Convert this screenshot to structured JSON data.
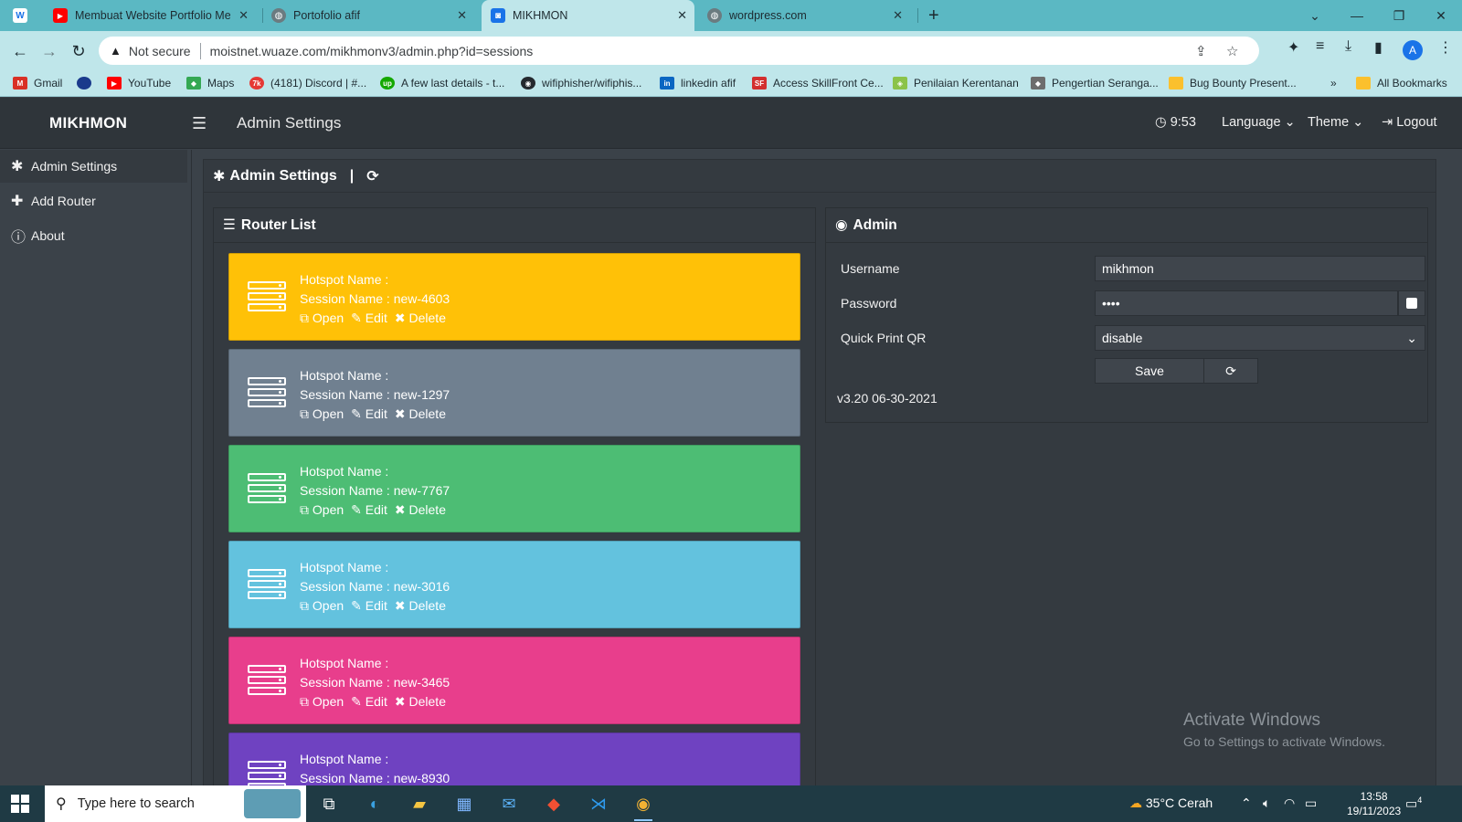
{
  "browser": {
    "tabs": [
      {
        "title": "Membuat Website Portfolio Men",
        "icon": "youtube-icon"
      },
      {
        "title": "Portofolio afif",
        "icon": "globe-icon"
      },
      {
        "title": "MIKHMON",
        "icon": "mikhmon-icon"
      },
      {
        "title": "wordpress.com",
        "icon": "globe-icon"
      }
    ],
    "not_secure": "Not secure",
    "url": "moistnet.wuaze.com/mikhmonv3/admin.php?id=sessions",
    "avatar": "A",
    "bookmarks": [
      {
        "label": "Gmail",
        "color": "#d93025"
      },
      {
        "label": "",
        "color": "#1a3a8c"
      },
      {
        "label": "YouTube",
        "color": "#ff0000"
      },
      {
        "label": "Maps",
        "color": "#34a853"
      },
      {
        "label": "(4181) Discord | #...",
        "color": "#e53935"
      },
      {
        "label": "A few last details - t...",
        "color": "#14a800"
      },
      {
        "label": "wifiphisher/wifiphis...",
        "color": "#24292e"
      },
      {
        "label": "linkedin afif",
        "color": "#0a66c2"
      },
      {
        "label": "Access SkillFront Ce...",
        "color": "#d32f2f"
      },
      {
        "label": "Penilaian Kerentanan",
        "color": "#8bc34a"
      },
      {
        "label": "Pengertian Seranga...",
        "color": "#6d6d6d"
      },
      {
        "label": "Bug Bounty Present...",
        "color": "#fbc02d"
      }
    ],
    "all_bookmarks": "All Bookmarks",
    "more_bookmarks": "»"
  },
  "app": {
    "brand": "MIKHMON",
    "page_title": "Admin Settings",
    "time": "9:53",
    "language": "Language",
    "theme": "Theme",
    "logout": "Logout"
  },
  "sidebar": {
    "items": [
      {
        "label": "Admin Settings",
        "icon": "gear-icon"
      },
      {
        "label": "Add Router",
        "icon": "plus-icon"
      },
      {
        "label": "About",
        "icon": "info-icon"
      }
    ]
  },
  "main": {
    "title": "Admin Settings",
    "separator": "|"
  },
  "router_list": {
    "title": "Router List",
    "hotspot_label": "Hotspot Name :",
    "session_label": "Session Name :",
    "open": "Open",
    "edit": "Edit",
    "delete": "Delete",
    "routers": [
      {
        "session": "new-4603",
        "color": "#ffc107"
      },
      {
        "session": "new-1297",
        "color": "#708090"
      },
      {
        "session": "new-7767",
        "color": "#4dbd74"
      },
      {
        "session": "new-3016",
        "color": "#63c2de"
      },
      {
        "session": "new-3465",
        "color": "#e83e8c"
      },
      {
        "session": "new-8930",
        "color": "#6f42c1"
      }
    ]
  },
  "admin": {
    "title": "Admin",
    "username_label": "Username",
    "username_value": "mikhmon",
    "password_label": "Password",
    "password_value": "••••",
    "qr_label": "Quick Print QR",
    "qr_value": "disable",
    "save": "Save",
    "version": "v3.20 06-30-2021"
  },
  "watermark": {
    "line1": "Activate Windows",
    "line2": "Go to Settings to activate Windows."
  },
  "taskbar": {
    "search_placeholder": "Type here to search",
    "weather": "35°C  Cerah",
    "time": "13:58",
    "date": "19/11/2023",
    "notifications": "4"
  }
}
